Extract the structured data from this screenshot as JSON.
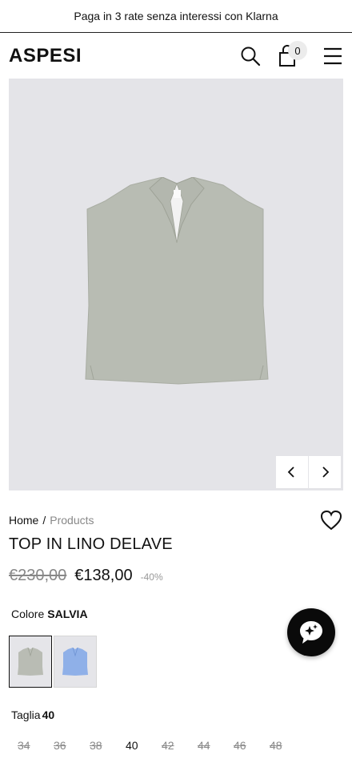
{
  "promo": {
    "text": "Paga in 3 rate senza interessi con Klarna"
  },
  "header": {
    "logo": "ASPESI",
    "cart_count": "0",
    "icons": [
      "search-icon",
      "bag-icon",
      "hamburger-menu-icon"
    ]
  },
  "gallery": {
    "image_alt": "product-image",
    "prev_icon": "chevron-left-icon",
    "next_icon": "chevron-right-icon"
  },
  "breadcrumb": {
    "home": "Home",
    "separator": "/",
    "current": "Products"
  },
  "product": {
    "title": "TOP IN LINO DELAVE",
    "old_price": "€230,00",
    "new_price": "€138,00",
    "discount": "-40%"
  },
  "color": {
    "label": "Colore",
    "selected": "SALVIA",
    "swatches": [
      {
        "name": "salvia",
        "color": "#b9bcb4",
        "active": true
      },
      {
        "name": "blue",
        "color": "#8fb0e8",
        "active": false
      }
    ]
  },
  "size": {
    "label": "Taglia",
    "selected": "40",
    "options": [
      {
        "value": "34",
        "available": false
      },
      {
        "value": "36",
        "available": false
      },
      {
        "value": "38",
        "available": false
      },
      {
        "value": "40",
        "available": true
      },
      {
        "value": "42",
        "available": false
      },
      {
        "value": "44",
        "available": false
      },
      {
        "value": "46",
        "available": false
      },
      {
        "value": "48",
        "available": false
      }
    ]
  },
  "colors": {
    "gallery_bg": "#e4e4e8",
    "garment": "#b8bcb3",
    "text": "#111111",
    "muted": "#888888"
  }
}
